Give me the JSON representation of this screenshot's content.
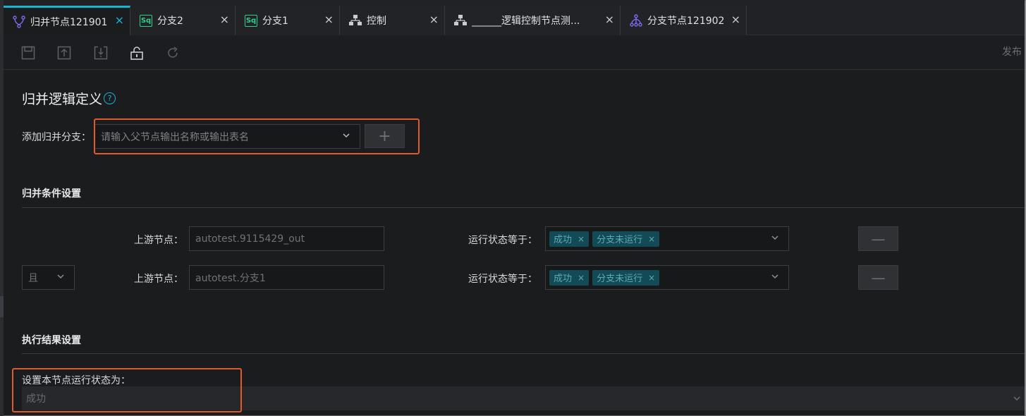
{
  "tabs": [
    {
      "label": "归并节点121901",
      "icon": "merge-node-icon",
      "active": true
    },
    {
      "label": "分支2",
      "icon": "sql-icon",
      "badge": "Sq"
    },
    {
      "label": "分支1",
      "icon": "sql-icon",
      "badge": "Sq"
    },
    {
      "label": "控制",
      "icon": "control-node-icon"
    },
    {
      "label": "______逻辑控制节点测...",
      "icon": "control-node-icon"
    },
    {
      "label": "分支节点121902",
      "icon": "branch-node-icon"
    }
  ],
  "tab_close": "×",
  "toolbar": {
    "publish_label": "发布",
    "tools": [
      "save-icon",
      "submit-icon",
      "download-icon",
      "unlock-icon",
      "refresh-icon"
    ]
  },
  "merge_def": {
    "title": "归并逻辑定义",
    "help": "?",
    "add_branch_label": "添加归并分支：",
    "add_branch_placeholder": "请输入父节点输出名称或输出表名",
    "add_button": "+"
  },
  "conditions": {
    "title": "归并条件设置",
    "rows": [
      {
        "logic": "",
        "upstream_label": "上游节点：",
        "upstream_value": "autotest.9115429_out",
        "status_label": "运行状态等于：",
        "tags": [
          "成功",
          "分支未运行"
        ],
        "remove": "—"
      },
      {
        "logic": "且",
        "upstream_label": "上游节点：",
        "upstream_value": "autotest.分支1",
        "status_label": "运行状态等于：",
        "tags": [
          "成功",
          "分支未运行"
        ],
        "remove": "—"
      }
    ],
    "tag_close": "×"
  },
  "result": {
    "title": "执行结果设置",
    "status_label": "设置本节点运行状态为：",
    "status_value": "成功"
  },
  "colors": {
    "accent": "#1ab3d4",
    "highlight": "#e05a2b",
    "tag_bg": "#124a55"
  }
}
